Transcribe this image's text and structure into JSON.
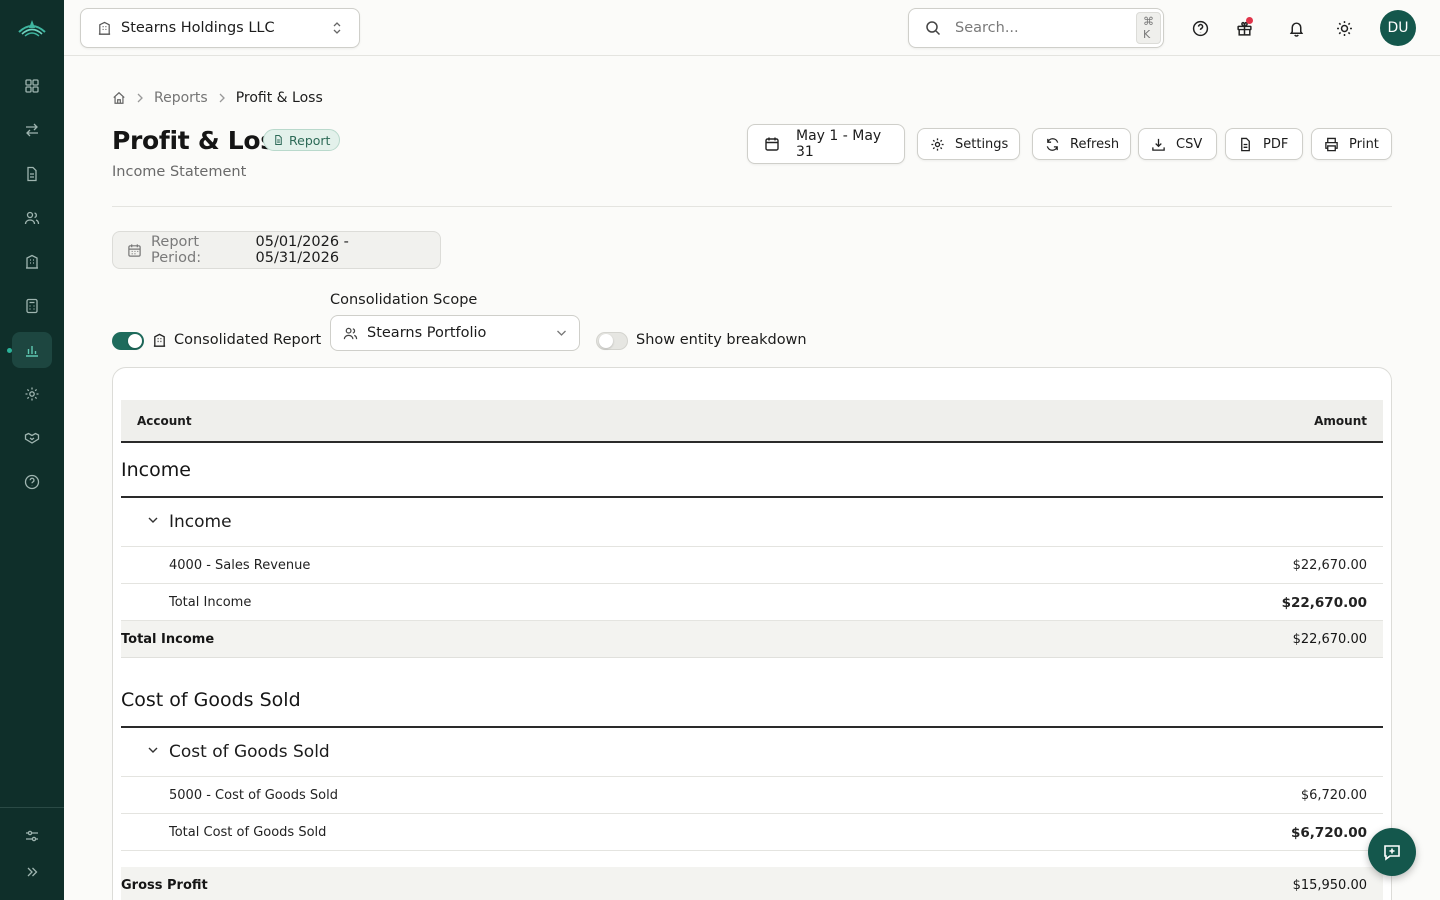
{
  "topbar": {
    "entity": "Stearns Holdings LLC",
    "search_placeholder": "Search...",
    "search_shortcut": "⌘ K",
    "avatar_initials": "DU"
  },
  "breadcrumb": {
    "items": [
      "Reports",
      "Profit & Loss"
    ]
  },
  "header": {
    "title": "Profit & Loss",
    "badge": "Report",
    "subtitle": "Income Statement"
  },
  "toolbar": {
    "date_range": "May 1 - May 31",
    "settings": "Settings",
    "refresh": "Refresh",
    "csv": "CSV",
    "pdf": "PDF",
    "print": "Print"
  },
  "period": {
    "label": "Report Period:",
    "value": "05/01/2026 - 05/31/2026"
  },
  "options": {
    "consolidated_label": "Consolidated Report",
    "consolidated_on": true,
    "scope_label": "Consolidation Scope",
    "scope_value": "Stearns Portfolio",
    "breakdown_label": "Show entity breakdown",
    "breakdown_on": false
  },
  "table": {
    "headers": {
      "account": "Account",
      "amount": "Amount"
    },
    "income": {
      "section": "Income",
      "group": "Income",
      "line_label": "4000 - Sales Revenue",
      "line_value": "$22,670.00",
      "subtotal_label": "Total Income",
      "subtotal_value": "$22,670.00",
      "total_label": "Total Income",
      "total_value": "$22,670.00"
    },
    "cogs": {
      "section": "Cost of Goods Sold",
      "group": "Cost of Goods Sold",
      "line_label": "5000 - Cost of Goods Sold",
      "line_value": "$6,720.00",
      "subtotal_label": "Total Cost of Goods Sold",
      "subtotal_value": "$6,720.00"
    },
    "gross_profit": {
      "label": "Gross Profit",
      "value": "$15,950.00"
    }
  },
  "colors": {
    "sidebar": "#0f2f2a",
    "accent": "#1e6b5c",
    "avatar": "#14574c"
  }
}
